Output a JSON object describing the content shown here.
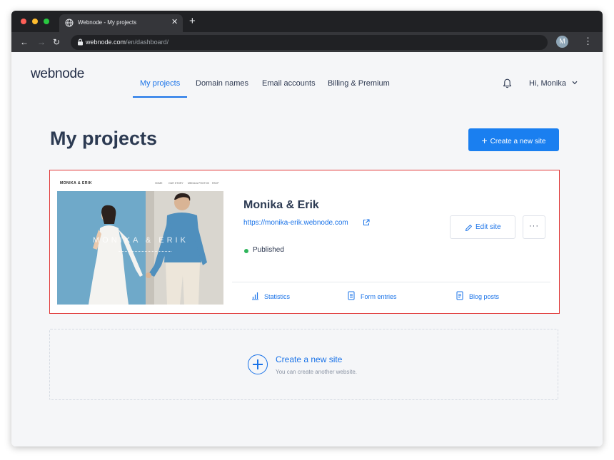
{
  "browser": {
    "tab_title": "Webnode - My projects",
    "tab_close": "✕",
    "new_tab": "+",
    "url_host": "webnode.com",
    "url_path": "/en/dashboard/",
    "profile_initial": "M"
  },
  "header": {
    "logo": "webnode",
    "nav": [
      "My projects",
      "Domain names",
      "Email accounts",
      "Billing & Premium"
    ],
    "active_nav": "My projects",
    "greeting": "Hi, Monika"
  },
  "main": {
    "title": "My projects",
    "create_button": "Create a new site"
  },
  "project": {
    "thumbnail": {
      "logo": "MONIKA & ERIK",
      "nav": [
        "HOME",
        "OUR STORY",
        "MEDIA & PHOTOS",
        "RSVP"
      ],
      "overlay_text": "MONIKA & ERIK"
    },
    "name": "Monika & Erik",
    "url": "https://monika-erik.webnode.com",
    "status": "Published",
    "edit_label": "Edit site",
    "more_label": "···",
    "links": [
      "Statistics",
      "Form entries",
      "Blog posts"
    ]
  },
  "empty_slot": {
    "title": "Create a new site",
    "subtitle": "You can create another website."
  },
  "colors": {
    "accent": "#1a73e8",
    "button": "#1a7ff0",
    "published": "#2fb55b",
    "highlight_border": "#e03a3a"
  }
}
